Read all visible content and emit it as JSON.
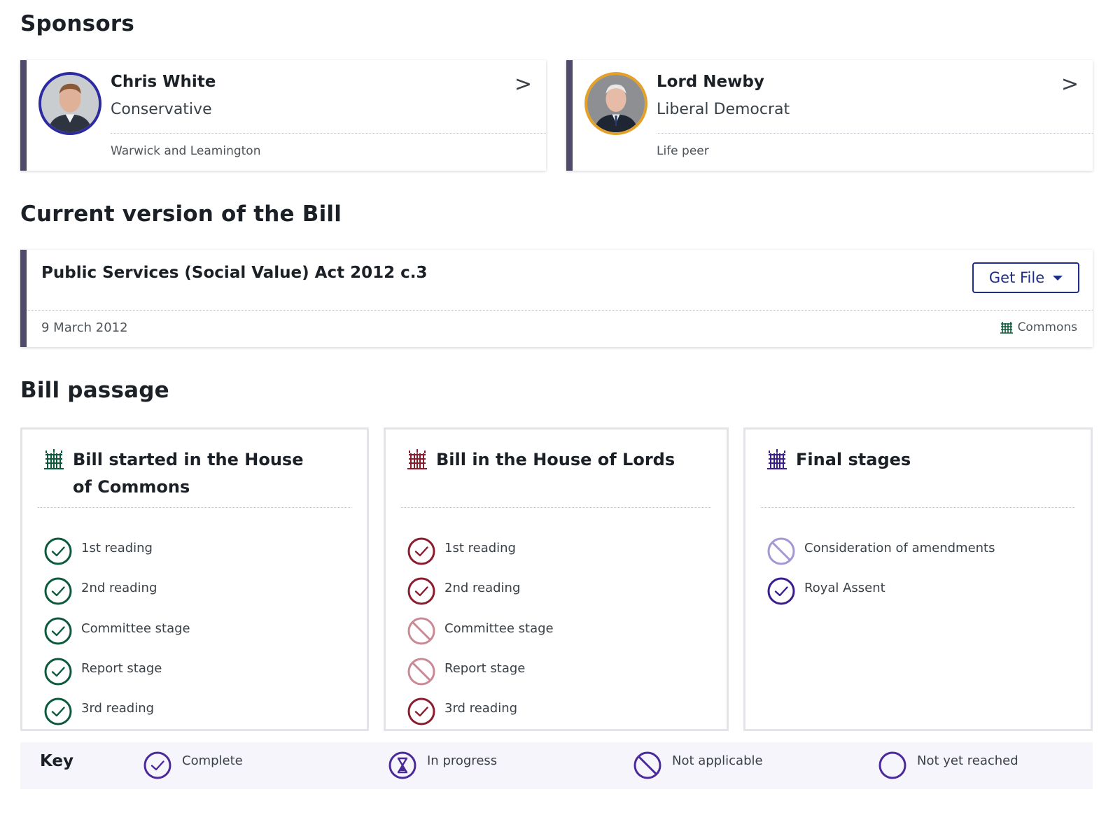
{
  "colors": {
    "commons": "#0b5a3b",
    "lords": "#8b1c2e",
    "lords_na": "#c98a96",
    "final": "#3b1d8f",
    "final_na": "#a596d4",
    "key": "#4a2a9a",
    "sidebar_accent": "#4f4a6e",
    "button": "#1f2e8a"
  },
  "sponsors": {
    "heading": "Sponsors",
    "items": [
      {
        "name": "Chris White",
        "party": "Conservative",
        "constituency": "Warwick and Leamington",
        "chevron": ">"
      },
      {
        "name": "Lord Newby",
        "party": "Liberal Democrat",
        "constituency": "Life peer",
        "chevron": ">"
      }
    ]
  },
  "current_version": {
    "heading": "Current version of the Bill",
    "title": "Public Services (Social Value) Act 2012 c.3",
    "date": "9 March 2012",
    "house": "Commons",
    "get_file_label": "Get File"
  },
  "bill_passage": {
    "heading": "Bill passage",
    "panels": [
      {
        "title": "Bill started in the House of Commons",
        "house": "commons",
        "stages": [
          {
            "label": "1st reading",
            "status": "complete"
          },
          {
            "label": "2nd reading",
            "status": "complete"
          },
          {
            "label": "Committee stage",
            "status": "complete"
          },
          {
            "label": "Report stage",
            "status": "complete"
          },
          {
            "label": "3rd reading",
            "status": "complete"
          }
        ]
      },
      {
        "title": "Bill in the House of Lords",
        "house": "lords",
        "stages": [
          {
            "label": "1st reading",
            "status": "complete"
          },
          {
            "label": "2nd reading",
            "status": "complete"
          },
          {
            "label": "Committee stage",
            "status": "not-applicable"
          },
          {
            "label": "Report stage",
            "status": "not-applicable"
          },
          {
            "label": "3rd reading",
            "status": "complete"
          }
        ]
      },
      {
        "title": "Final stages",
        "house": "final",
        "stages": [
          {
            "label": "Consideration of amendments",
            "status": "not-applicable"
          },
          {
            "label": "Royal Assent",
            "status": "complete"
          }
        ]
      }
    ]
  },
  "key": {
    "title": "Key",
    "items": [
      {
        "label": "Complete",
        "icon": "check-circle-icon"
      },
      {
        "label": "In progress",
        "icon": "hourglass-icon"
      },
      {
        "label": "Not applicable",
        "icon": "not-applicable-icon"
      },
      {
        "label": "Not yet reached",
        "icon": "empty-circle-icon"
      }
    ]
  }
}
